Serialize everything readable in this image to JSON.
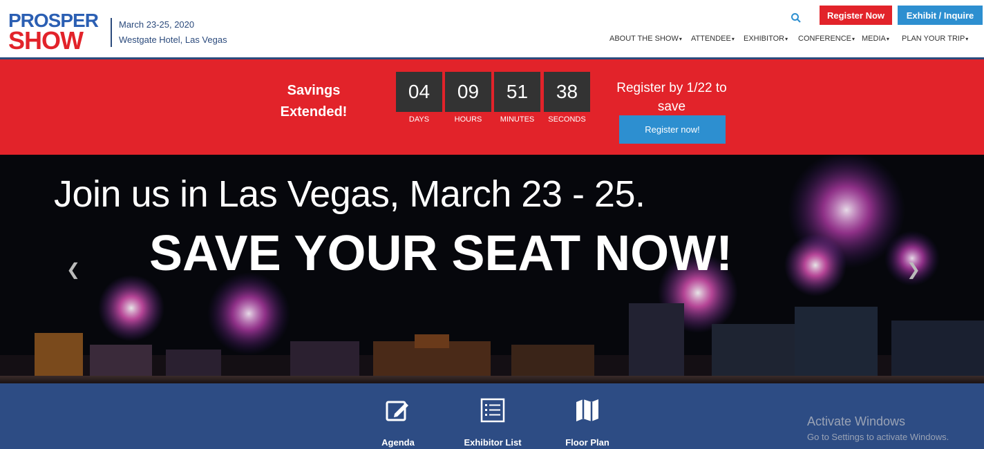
{
  "header": {
    "logo_top": "PROSPER",
    "logo_bottom": "SHOW",
    "event_date": "March 23-25, 2020",
    "event_venue": "Westgate Hotel, Las Vegas",
    "register_label": "Register Now",
    "exhibit_label": "Exhibit / Inquire",
    "nav": [
      {
        "label": "ABOUT THE SHOW"
      },
      {
        "label": "ATTENDEE"
      },
      {
        "label": "EXHIBITOR"
      },
      {
        "label": "CONFERENCE"
      },
      {
        "label": "MEDIA"
      },
      {
        "label": "PLAN YOUR TRIP"
      }
    ]
  },
  "promo": {
    "savings_text": "Savings Extended!",
    "countdown": [
      {
        "value": "04",
        "label": "DAYS"
      },
      {
        "value": "09",
        "label": "HOURS"
      },
      {
        "value": "51",
        "label": "MINUTES"
      },
      {
        "value": "38",
        "label": "SECONDS"
      }
    ],
    "register_text": "Register by 1/22 to save",
    "register_button": "Register now!"
  },
  "hero": {
    "line1": "Join us in Las Vegas, March 23 - 25.",
    "line2": "SAVE YOUR SEAT NOW!",
    "prev_icon": "chevron-left-icon",
    "next_icon": "chevron-right-icon"
  },
  "quick_links": [
    {
      "label": "Agenda",
      "icon": "edit-icon"
    },
    {
      "label": "Exhibitor List",
      "icon": "list-icon"
    },
    {
      "label": "Floor Plan",
      "icon": "map-icon"
    }
  ],
  "watermark": {
    "title": "Activate Windows",
    "subtitle": "Go to Settings to activate Windows."
  },
  "colors": {
    "brand_red": "#e2232a",
    "brand_blue": "#2b5fb3",
    "button_blue": "#2d8fd0",
    "navy": "#2d4c84"
  }
}
